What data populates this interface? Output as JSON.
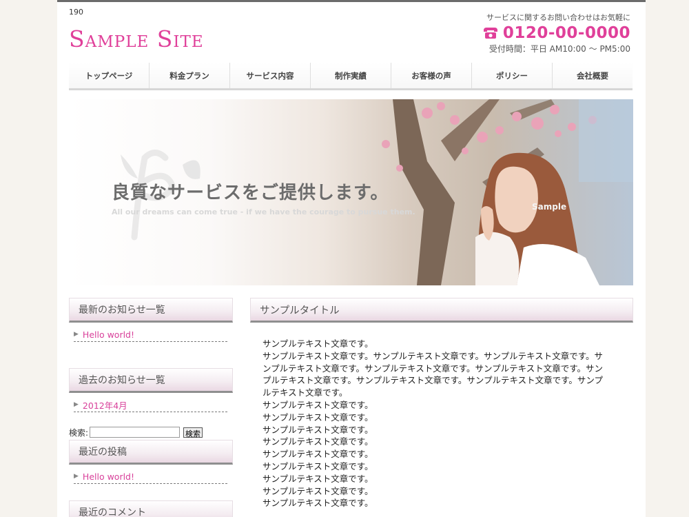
{
  "header": {
    "top_number": "190",
    "logo": "Sample Site",
    "contact_note": "サービスに関するお問い合わせはお気軽に",
    "phone": "0120-00-0000",
    "hours": "受付時間：平日 AM10:00 〜 PM5:00"
  },
  "nav": {
    "items": [
      "トップページ",
      "料金プラン",
      "サービス内容",
      "制作実績",
      "お客様の声",
      "ポリシー",
      "会社概要"
    ]
  },
  "hero": {
    "title": "良質なサービスをご提供します。",
    "subtitle": "All our dreams can come true - if we have the courage to pursue them.",
    "sample": "Sample"
  },
  "sidebar": {
    "latest_news_title": "最新のお知らせ一覧",
    "latest_news_items": [
      "Hello world!"
    ],
    "archive_title": "過去のお知らせ一覧",
    "archive_items": [
      "2012年4月"
    ],
    "search_label": "検索:",
    "search_value": "",
    "search_button": "検索",
    "recent_posts_title": "最近の投稿",
    "recent_posts_items": [
      "Hello world!"
    ],
    "recent_comments_title": "最近のコメント"
  },
  "main": {
    "title": "サンプルタイトル",
    "lines": [
      "サンプルテキスト文章です。",
      "サンプルテキスト文章です。サンプルテキスト文章です。サンプルテキスト文章です。サ",
      "ンプルテキスト文章です。サンプルテキスト文章です。サンプルテキスト文章です。サン",
      "プルテキスト文章です。サンプルテキスト文章です。サンプルテキスト文章です。サンプ",
      "ルテキスト文章です。",
      "サンプルテキスト文章です。",
      "サンプルテキスト文章です。",
      "サンプルテキスト文章です。",
      "サンプルテキスト文章です。",
      "サンプルテキスト文章です。",
      "サンプルテキスト文章です。",
      "サンプルテキスト文章です。",
      "サンプルテキスト文章です。",
      "サンプルテキスト文章です。"
    ]
  },
  "colors": {
    "accent": "#e0409a",
    "link": "#d8409a"
  }
}
